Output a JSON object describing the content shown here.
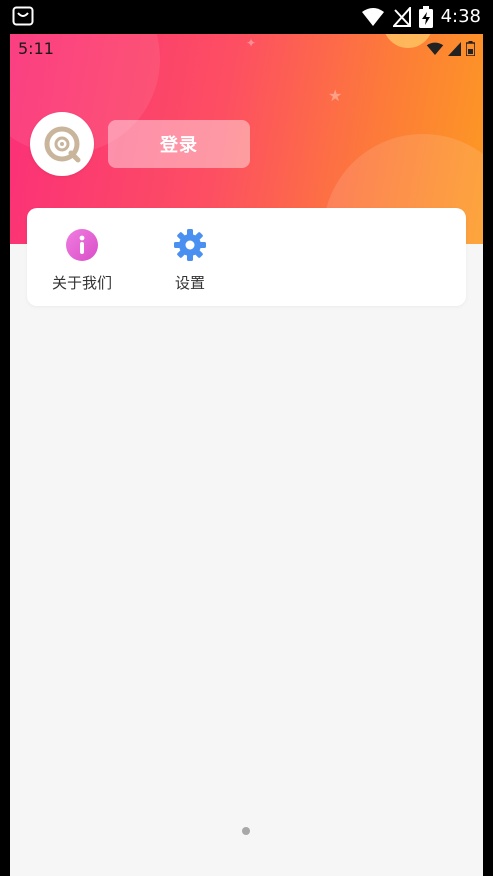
{
  "system_status": {
    "time": "4:38",
    "icons": [
      "notification-icon",
      "wifi-icon",
      "no-signal-icon",
      "battery-charging-icon"
    ]
  },
  "app_status": {
    "time": "5:11",
    "icons": [
      "wifi-icon",
      "signal-icon",
      "battery-icon"
    ]
  },
  "header": {
    "avatar_icon": "app-logo-icon",
    "login_label": "登录",
    "colors": {
      "gradient_start": "#fb2f79",
      "gradient_end": "#fd9a22"
    }
  },
  "menu": {
    "items": [
      {
        "label": "关于我们",
        "icon": "info-icon",
        "color": "#e55bd6"
      },
      {
        "label": "设置",
        "icon": "gear-icon",
        "color": "#4a90f0"
      }
    ]
  },
  "pager": {
    "pages": 1,
    "current": 1
  }
}
